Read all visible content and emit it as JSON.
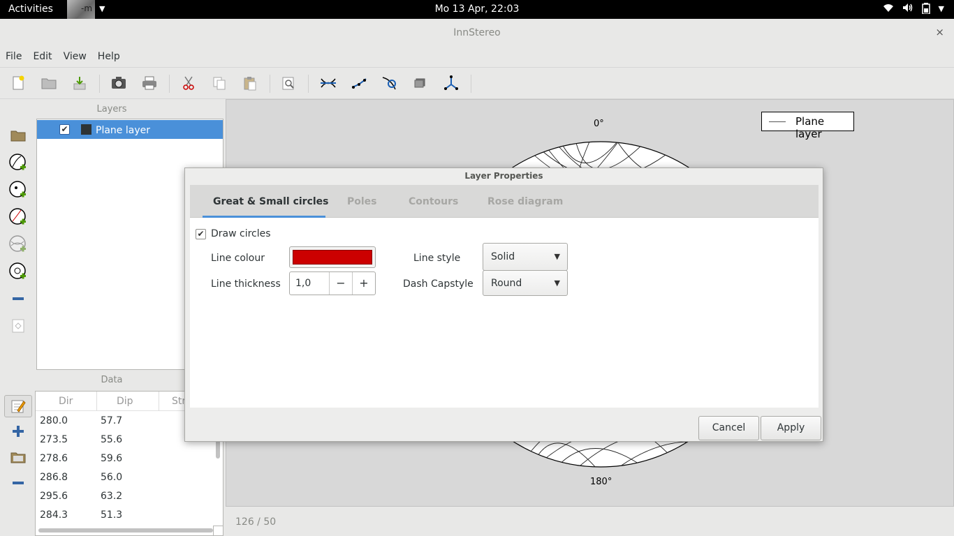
{
  "topbar": {
    "activities": "Activities",
    "app_thumb_text": "-m",
    "clock": "Mo 13 Apr, 22:03"
  },
  "window": {
    "title": "InnStereo",
    "close": "×"
  },
  "menu": [
    "File",
    "Edit",
    "View",
    "Help"
  ],
  "layers": {
    "heading": "Layers",
    "items": [
      {
        "name": "Plane layer",
        "checked": true,
        "swatch_color": "#2e3436"
      }
    ]
  },
  "data_panel": {
    "heading": "Data",
    "columns": [
      "Dir",
      "Dip",
      "Str"
    ],
    "rows": [
      [
        "280.0",
        "57.7"
      ],
      [
        "273.5",
        "55.6"
      ],
      [
        "278.6",
        "59.6"
      ],
      [
        "286.8",
        "56.0"
      ],
      [
        "295.6",
        "63.2"
      ],
      [
        "284.3",
        "51.3"
      ]
    ]
  },
  "plot": {
    "legend": "Plane layer",
    "north_label": "0°",
    "south_label": "180°",
    "status": "126 / 50"
  },
  "dialog": {
    "title": "Layer Properties",
    "tabs": [
      "Great & Small circles",
      "Poles",
      "Contours",
      "Rose diagram"
    ],
    "active_tab": 0,
    "draw_circles_label": "Draw circles",
    "draw_circles_checked": true,
    "line_colour_label": "Line colour",
    "line_colour_value": "#cc0000",
    "line_thickness_label": "Line thickness",
    "line_thickness_value": "1,0",
    "line_style_label": "Line style",
    "line_style_value": "Solid",
    "dash_capstyle_label": "Dash Capstyle",
    "dash_capstyle_value": "Round",
    "cancel": "Cancel",
    "apply": "Apply"
  },
  "colors": {
    "accent": "#4a90d9",
    "line_colour": "#cc0000"
  },
  "icons": {
    "toolbar": [
      "new-file-icon",
      "open-folder-icon",
      "save-download-icon",
      "screenshot-camera-icon",
      "print-icon",
      "cut-icon",
      "copy-icon",
      "paste-icon",
      "zoom-icon",
      "great-circle-icon",
      "fit-line-icon",
      "small-circle-icon",
      "rotate-icon",
      "eigenvector-icon"
    ],
    "sidebar": [
      "open-folder-icon",
      "add-plane-layer-icon",
      "add-line-layer-icon",
      "add-faultplane-layer-icon",
      "add-smallcircle-layer-icon",
      "add-eigenvector-layer-icon",
      "remove-layer-icon",
      "layer-properties-icon"
    ],
    "data_sidebar": [
      "edit-data-icon",
      "add-row-icon",
      "import-data-icon",
      "remove-row-icon"
    ]
  }
}
